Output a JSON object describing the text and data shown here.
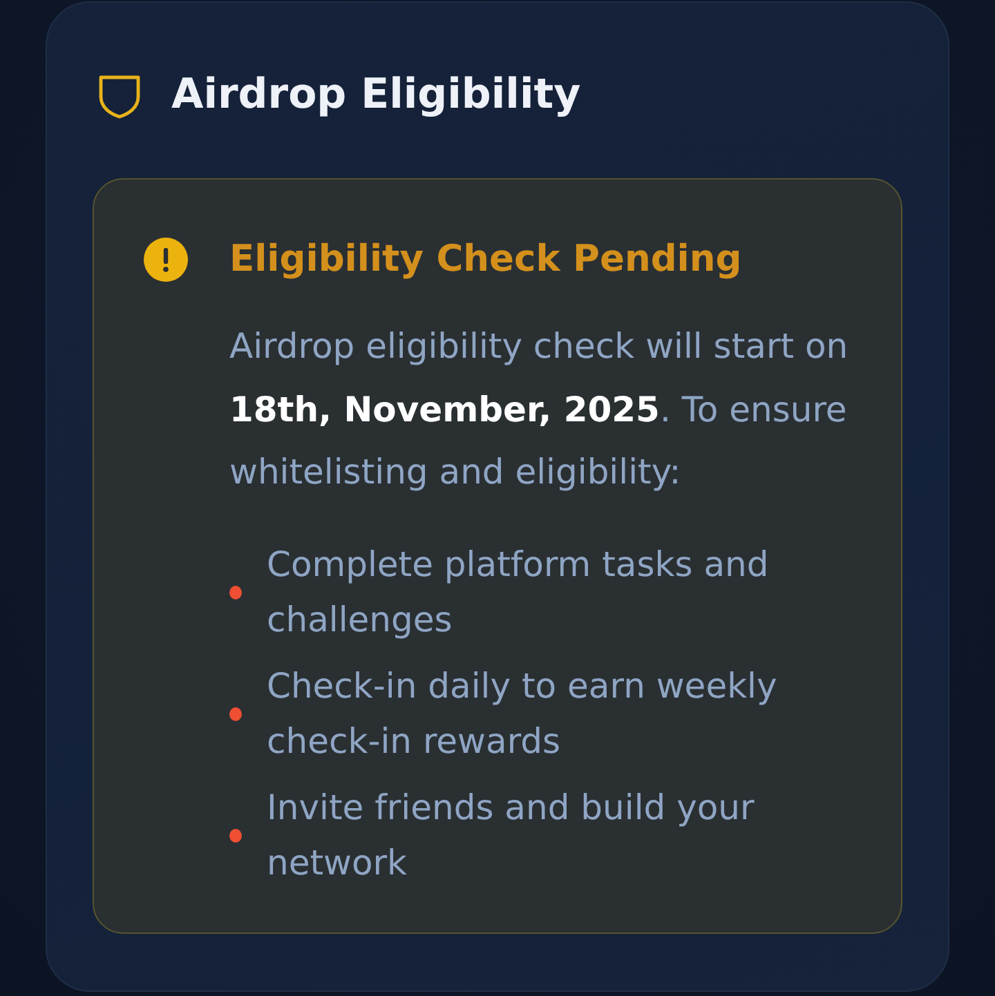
{
  "card": {
    "title": "Airdrop Eligibility"
  },
  "notice": {
    "heading": "Eligibility Check Pending",
    "message": "Airdrop eligibility check will start on **18th, November, 2025**. To ensure whitelisting and eligibility:",
    "items": [
      "Complete platform tasks and challenges",
      "Check-in daily to earn weekly check-in rewards",
      "Invite friends and build your network"
    ]
  }
}
